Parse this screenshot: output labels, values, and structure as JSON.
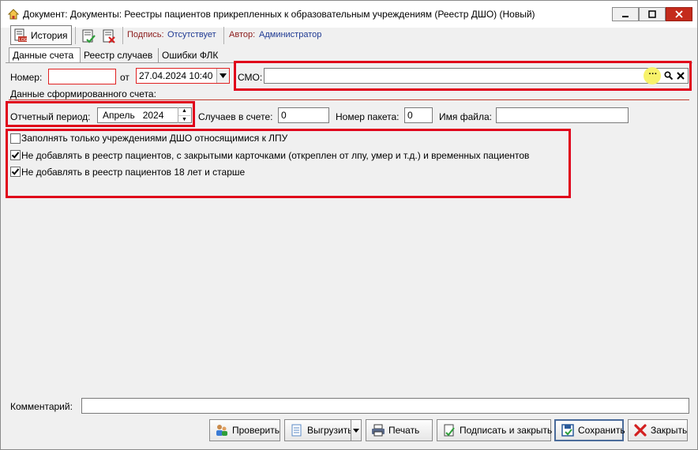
{
  "window": {
    "title": "Документ: Документы: Реестры пациентов прикрепленных к образовательным учреждениям (Реестр ДШО) (Новый)"
  },
  "toolbar": {
    "history_label": "История",
    "signature_label": "Подпись:",
    "signature_value": "Отсутствует",
    "author_label": "Автор:",
    "author_value": "Администратор"
  },
  "tabs": [
    {
      "label": "Данные счета"
    },
    {
      "label": "Реестр случаев"
    },
    {
      "label": "Ошибки ФЛК"
    }
  ],
  "form": {
    "number_label": "Номер:",
    "number_value": "",
    "from_label": "от",
    "date_value": "27.04.2024 10:40",
    "smo_label": "СМО:",
    "smo_value": "",
    "section_title": "Данные сформированного счета:",
    "period_label": "Отчетный период:",
    "period_value": "Апрель   2024",
    "cases_label": "Случаев в счете:",
    "cases_value": "0",
    "packet_label": "Номер пакета:",
    "packet_value": "0",
    "filename_label": "Имя файла:",
    "filename_value": "",
    "checkboxes": [
      {
        "label": "Заполнять только учреждениями ДШО относящимися к ЛПУ",
        "checked": false
      },
      {
        "label": "Не добавлять в реестр пациентов, с закрытыми карточками (откреплен от лпу, умер и т.д.) и временных пациентов",
        "checked": true
      },
      {
        "label": "Не добавлять в реестр пациентов 18 лет и старше",
        "checked": true
      }
    ],
    "comment_label": "Комментарий:",
    "comment_value": ""
  },
  "buttons": {
    "check": "Проверить",
    "export": "Выгрузить",
    "print": "Печать",
    "sign_close": "Подписать и закрыть",
    "save": "Сохранить",
    "close": "Закрыть"
  },
  "colors": {
    "highlight_box": "#e0001a",
    "signature_text": "#1f3a93",
    "author_text": "#1f3a93"
  }
}
